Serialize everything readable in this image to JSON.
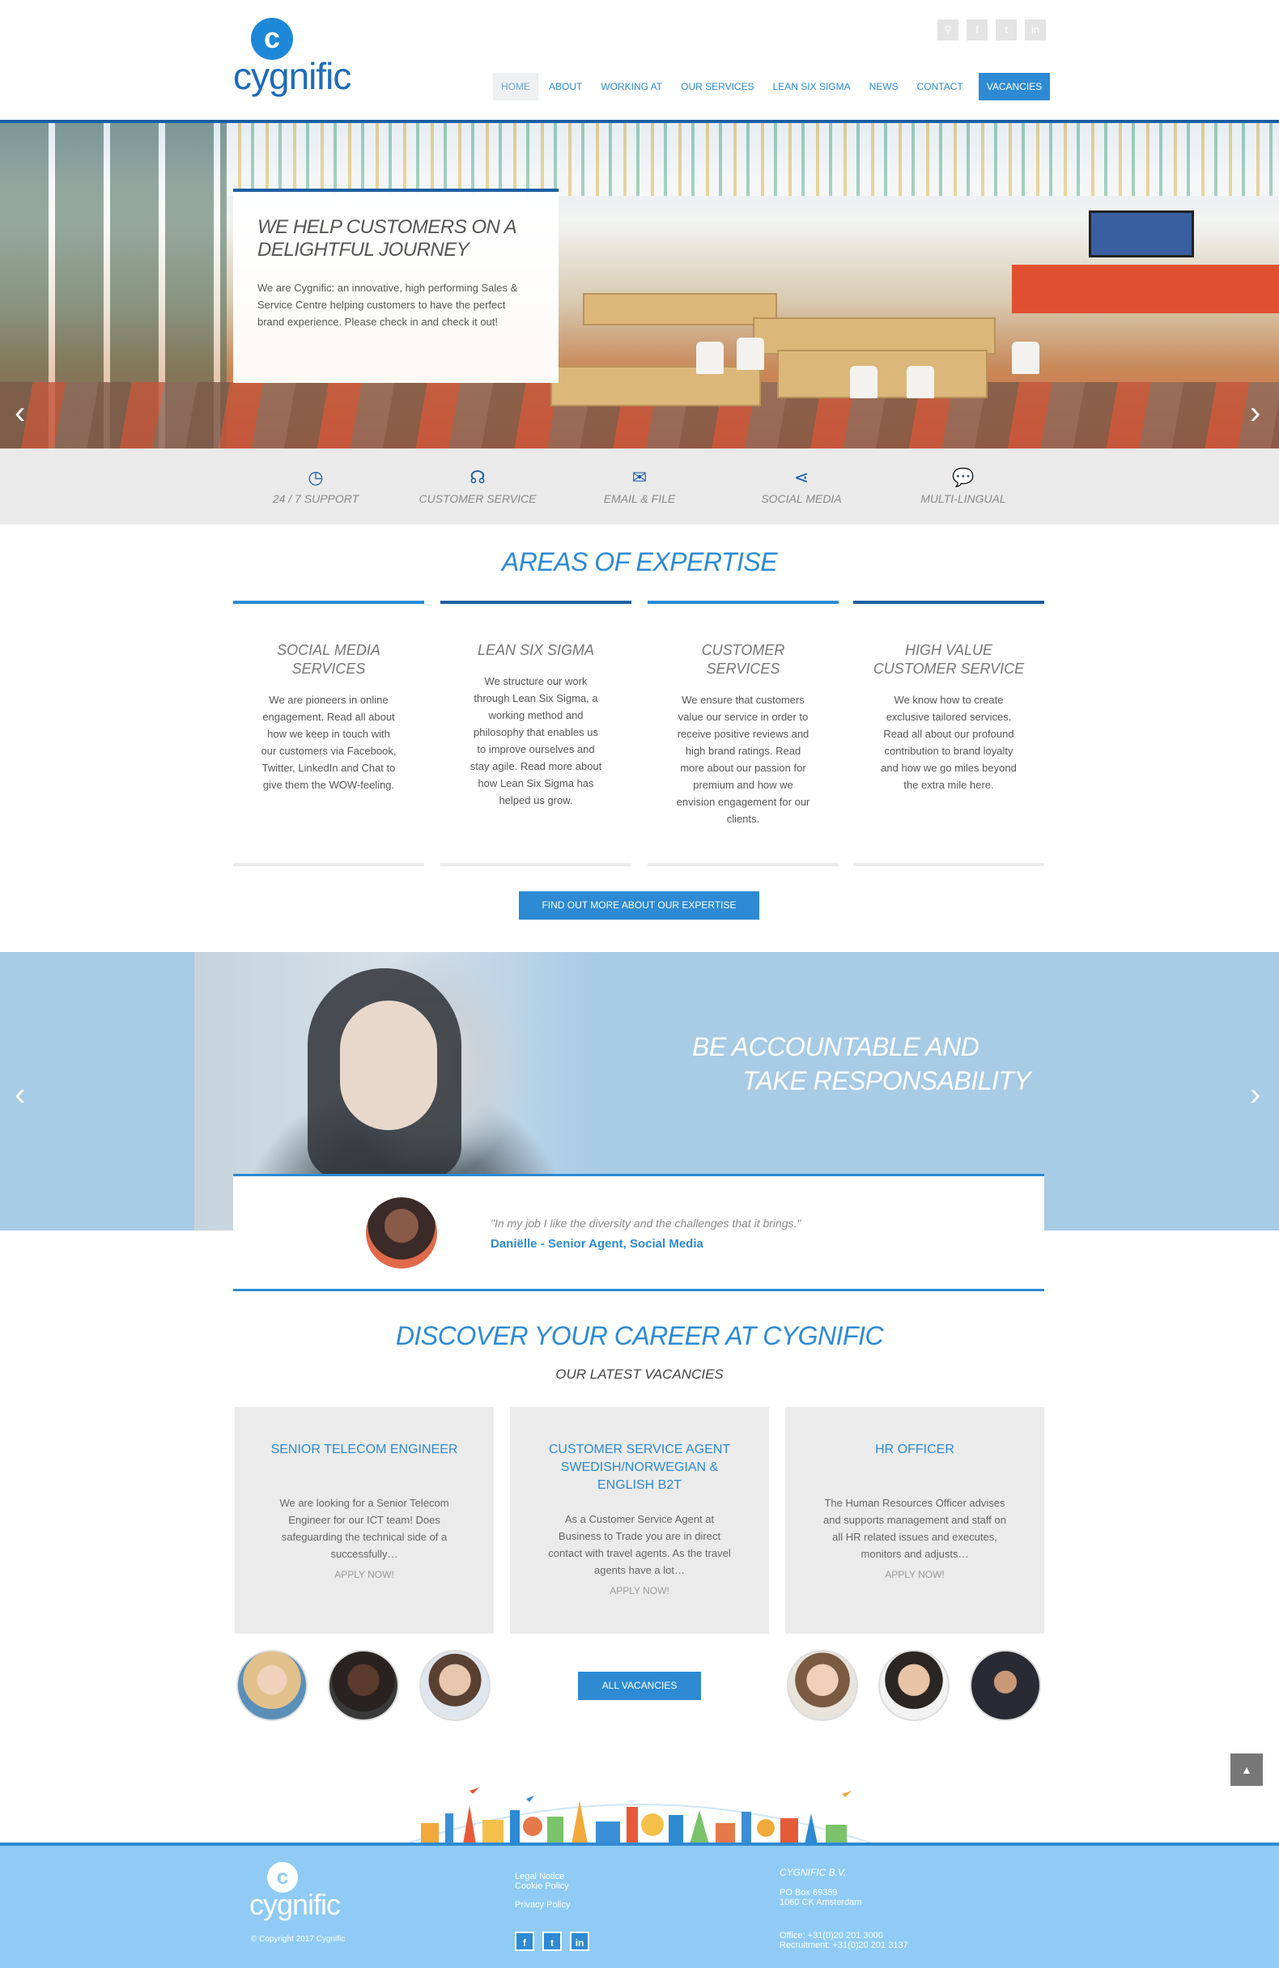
{
  "brand": {
    "logo_letter": "c",
    "logo_text": "cygnific"
  },
  "header": {
    "social": [
      "search-icon",
      "facebook-icon",
      "twitter-icon",
      "linkedin-icon"
    ],
    "social_glyphs": [
      "⚲",
      "f",
      "t",
      "in"
    ],
    "nav": [
      "HOME",
      "ABOUT",
      "WORKING AT",
      "OUR SERVICES",
      "LEAN SIX SIGMA",
      "NEWS",
      "CONTACT",
      "VACANCIES"
    ]
  },
  "hero": {
    "title": "WE HELP CUSTOMERS ON A DELIGHTFUL JOURNEY",
    "text": "We are Cygnific: an innovative, high performing Sales & Service Centre helping customers to have the perfect brand experience. Please check in and check it out!",
    "prev": "‹",
    "next": "›"
  },
  "features": [
    {
      "icon": "clock-icon",
      "glyph": "◷",
      "label": "24 / 7 SUPPORT"
    },
    {
      "icon": "headset-icon",
      "glyph": "☊",
      "label": "CUSTOMER SERVICE"
    },
    {
      "icon": "envelope-icon",
      "glyph": "✉",
      "label": "EMAIL & FILE"
    },
    {
      "icon": "share-icon",
      "glyph": "⋖",
      "label": "SOCIAL MEDIA"
    },
    {
      "icon": "speech-bubbles-icon",
      "glyph": "💬",
      "label": "MULTI-LINGUAL"
    }
  ],
  "expertise": {
    "title": "AREAS OF EXPERTISE",
    "cards": [
      {
        "title": "SOCIAL MEDIA SERVICES",
        "text": "We are pioneers in online engagement. Read all about how we keep in touch with our customers via Facebook, Twitter, LinkedIn and Chat to give them the WOW-feeling."
      },
      {
        "title": "LEAN SIX SIGMA",
        "text": "We structure our work through Lean Six Sigma, a working method and philosophy that enables us to improve ourselves and stay agile. Read more about how Lean Six Sigma has helped us grow."
      },
      {
        "title": "CUSTOMER SERVICES",
        "text": "We ensure that customers value our service in order to receive positive reviews and high brand ratings. Read more about our passion for premium and how we envision engagement for our clients."
      },
      {
        "title": "HIGH VALUE CUSTOMER SERVICE",
        "text": "We know how to create exclusive tailored services. Read all about our profound contribution to brand loyalty and how we go miles beyond the extra mile here."
      }
    ],
    "button": "FIND OUT MORE ABOUT OUR EXPERTISE"
  },
  "band": {
    "line1": "BE ACCOUNTABLE AND",
    "line2": "TAKE RESPONSABILITY",
    "prev": "‹",
    "next": "›"
  },
  "testimonial": {
    "quote": "\"In my job I like the diversity and the challenges that it brings.\"",
    "name": "Daniëlle - Senior Agent, Social Media"
  },
  "career": {
    "title": "DISCOVER YOUR CAREER AT CYGNIFIC",
    "subtitle": "OUR LATEST VACANCIES",
    "vacancies": [
      {
        "title": "SENIOR TELECOM ENGINEER",
        "text": "We are looking for a Senior Telecom Engineer for our ICT team! Does safeguarding the technical side of a successfully…",
        "apply": "APPLY NOW!"
      },
      {
        "title": "CUSTOMER SERVICE AGENT SWEDISH/NORWEGIAN & ENGLISH B2T",
        "text": "As a Customer Service Agent at Business to Trade you are in direct contact with travel agents. As the travel agents have a lot…",
        "apply": "APPLY NOW!"
      },
      {
        "title": "HR OFFICER",
        "text": "The Human Resources Officer advises and supports management and staff on all HR related issues and executes, monitors and adjusts…",
        "apply": "APPLY NOW!"
      }
    ],
    "button": "ALL VACANCIES",
    "scroll_top": "▲"
  },
  "footer": {
    "logo_letter": "c",
    "logo_text": "cygnific",
    "copyright": "© Copyright 2017 Cygnific",
    "links": [
      "Legal Notice",
      "Cookie Policy",
      "Privacy Policy"
    ],
    "social": [
      "f",
      "t",
      "in"
    ],
    "company": "CYGNIFIC B.V.",
    "po_box": "PO Box 69359",
    "postcode": "1060 CK Amsterdam",
    "office": "Office: +31(0)20 201 3000",
    "recruitment": "Recruitment: +31(0)20 201 3137"
  },
  "colors": {
    "primary": "#2d8ad3",
    "dark": "#1d5fa3",
    "band": "#a8cbe6",
    "footer": "#8fcbf4"
  }
}
